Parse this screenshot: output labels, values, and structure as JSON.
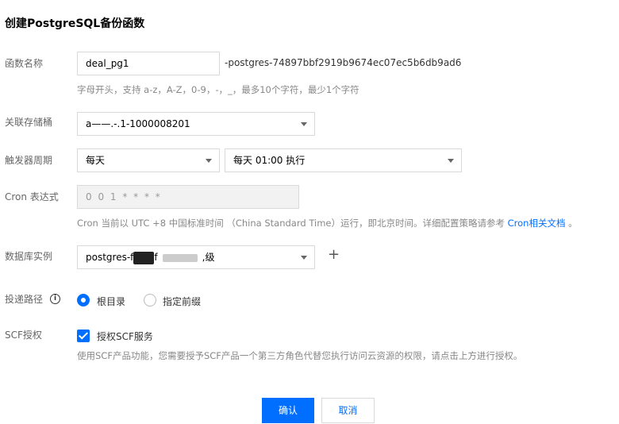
{
  "page": {
    "title": "创建PostgreSQL备份函数"
  },
  "function_name": {
    "label": "函数名称",
    "value": "deal_pg1",
    "suffix": "-postgres-74897bbf2919b9674ec07ec5b6db9ad6",
    "hint": "字母开头，支持 a-z，A-Z，0-9，-，_，最多10个字符，最少1个字符"
  },
  "bucket": {
    "label": "关联存储桶",
    "value": "a——.-.1-1000008201"
  },
  "trigger": {
    "label": "触发器周期",
    "period": "每天",
    "time": "每天 01:00 执行"
  },
  "cron": {
    "label": "Cron 表达式",
    "value": "0 0 1 * * * *",
    "hint_prefix": "Cron 当前以 UTC +8 中国标准时间 （China Standard Time）运行，即北京时间。详细配置策略请参考",
    "hint_link": "Cron相关文档",
    "hint_suffix": "。"
  },
  "db_instance": {
    "label": "数据库实例",
    "value_prefix": "postgres-f",
    "value_mid": "f",
    "value_suffix": ",级",
    "add_symbol": "+"
  },
  "delivery_path": {
    "label": "投递路径",
    "info_symbol": "i",
    "options": [
      {
        "label": "根目录",
        "selected": true
      },
      {
        "label": "指定前缀",
        "selected": false
      }
    ]
  },
  "scf": {
    "label": "SCF授权",
    "checkbox_label": "授权SCF服务",
    "checked": true,
    "hint": "使用SCF产品功能，您需要授予SCF产品一个第三方角色代替您执行访问云资源的权限，请点击上方进行授权。"
  },
  "buttons": {
    "confirm": "确认",
    "cancel": "取消"
  },
  "colors": {
    "primary": "#006eff",
    "label": "#666666",
    "hint": "#888888",
    "border": "#d9d9d9"
  }
}
